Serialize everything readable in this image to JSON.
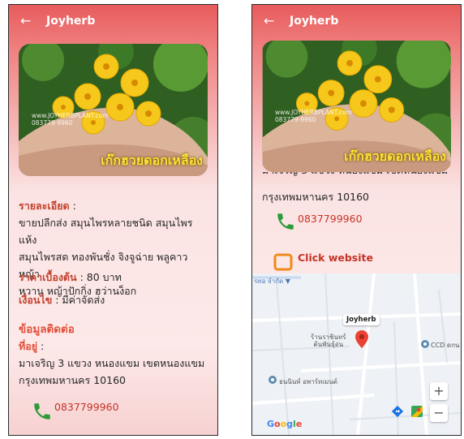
{
  "app": {
    "title": "Joyherb"
  },
  "hero": {
    "caption": "เก๊กฮวยดอกเหลือง",
    "watermark_line1": "www.JOYHERBPLANT.com",
    "watermark_line2": "083779-9960"
  },
  "details": {
    "label": "รายละเอียด",
    "colon": " :",
    "lines": [
      "ขายปลีกส่ง สมุนไพรหลายชนิด สมุนไพรแห้ง",
      "สมุนไพรสด ทองพันชั่ง จิงจูฉ่าย พลูคาว หญ้า",
      "หวาน หญ้าปักกิ่ง ฮว่านง็อก"
    ]
  },
  "price": {
    "label": "ราคาเบื้องต้น",
    "value": " : 80 บาท"
  },
  "condition": {
    "label": "เงื่อนไข",
    "value": " : มีค่าจัดส่ง"
  },
  "contact": {
    "heading": "ข้อมูลติดต่อ",
    "address_label": "ที่อยู่",
    "address_colon": " :",
    "address_line1": "มาเจริญ 3 แขวง หนองแขม เขตหนองแขม",
    "address_line2": "กรุงเทพมหานคร 10160",
    "phone": "0837799960"
  },
  "website": {
    "label": "Click website"
  },
  "map": {
    "pin_name": "Joyherb",
    "store_line1": "ร้านราชินทร์",
    "store_line2": "ต้นพันธุ์อ่น",
    "poi_ccd": "CCD ดกน",
    "poi_thanin": "ธนนินท์ อพาร์ทเมนต์",
    "top_label": "รทอ จำกัด",
    "top_arrow": "▼",
    "zoom_in": "+",
    "zoom_out": "−",
    "google": [
      "G",
      "o",
      "o",
      "g",
      "l",
      "e"
    ],
    "colors": {
      "pin": "#ea4335",
      "poi": "#5f8bb0",
      "water": "#a9c8e8"
    }
  },
  "colors": {
    "header": "#e85c5c",
    "label": "#c2412c",
    "heading": "#e24f3a",
    "phone_green": "#2e9b3a",
    "website_orange": "#f08a1a"
  }
}
